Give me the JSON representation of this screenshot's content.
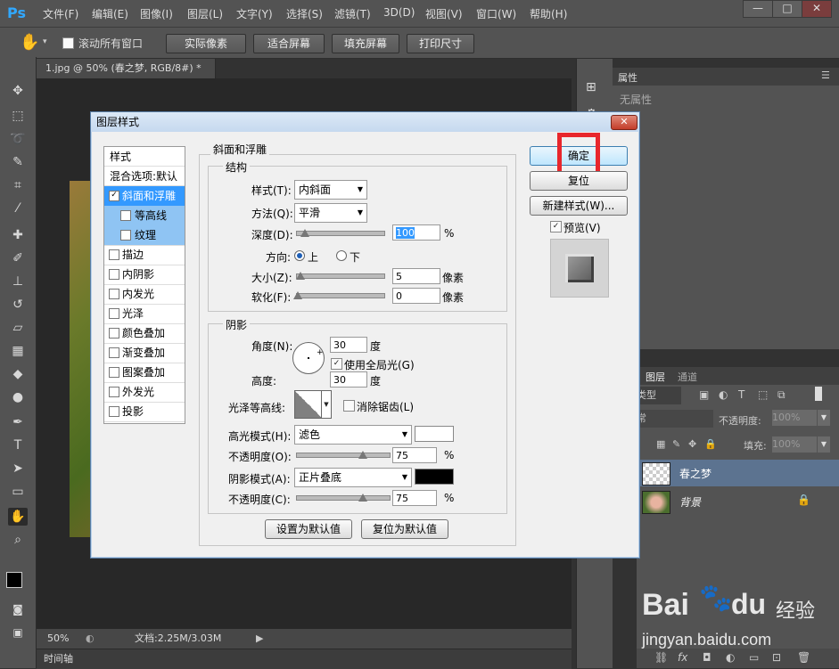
{
  "menubar": {
    "logo": "Ps",
    "items": [
      "文件(F)",
      "编辑(E)",
      "图像(I)",
      "图层(L)",
      "文字(Y)",
      "选择(S)",
      "滤镜(T)",
      "3D(D)",
      "视图(V)",
      "窗口(W)",
      "帮助(H)"
    ],
    "minimize": "—",
    "maximize": "□",
    "close": "✕"
  },
  "options": {
    "scroll_all_label": "滚动所有窗口",
    "buttons": [
      "实际像素",
      "适合屏幕",
      "填充屏幕",
      "打印尺寸"
    ]
  },
  "document": {
    "tab_title": "1.jpg @ 50% (春之梦, RGB/8#) *",
    "zoom": "50%",
    "doc_info": "文档:2.25M/3.03M",
    "timeline": "时间轴"
  },
  "properties": {
    "tab": "属性",
    "empty": "无属性"
  },
  "layers": {
    "tabs": [
      "图层",
      "通道"
    ],
    "filter_label": "类型",
    "blend_mode": "常",
    "opacity_label": "不透明度:",
    "opacity_value": "100%",
    "lock_label": "锁:",
    "fill_label": "填充:",
    "fill_value": "100%",
    "items": [
      {
        "name": "春之梦",
        "selected": true
      },
      {
        "name": "背景",
        "selected": false,
        "locked": true
      }
    ]
  },
  "dialog": {
    "title": "图层样式",
    "close": "✕",
    "style_list": {
      "header": "样式",
      "blend_default": "混合选项:默认",
      "items": [
        {
          "label": "斜面和浮雕",
          "checked": true,
          "active": true
        },
        {
          "label": "等高线",
          "checked": false,
          "sub": true
        },
        {
          "label": "纹理",
          "checked": false,
          "sub": true
        },
        {
          "label": "描边",
          "checked": false
        },
        {
          "label": "内阴影",
          "checked": false
        },
        {
          "label": "内发光",
          "checked": false
        },
        {
          "label": "光泽",
          "checked": false
        },
        {
          "label": "颜色叠加",
          "checked": false
        },
        {
          "label": "渐变叠加",
          "checked": false
        },
        {
          "label": "图案叠加",
          "checked": false
        },
        {
          "label": "外发光",
          "checked": false
        },
        {
          "label": "投影",
          "checked": false
        }
      ]
    },
    "bevel": {
      "section": "斜面和浮雕",
      "structure": "结构",
      "style_label": "样式(T):",
      "style_value": "内斜面",
      "method_label": "方法(Q):",
      "method_value": "平滑",
      "depth_label": "深度(D):",
      "depth_value": "100",
      "percent": "%",
      "direction_label": "方向:",
      "dir_up": "上",
      "dir_down": "下",
      "size_label": "大小(Z):",
      "size_value": "5",
      "soften_label": "软化(F):",
      "soften_value": "0",
      "px": "像素"
    },
    "shading": {
      "section": "阴影",
      "angle_label": "角度(N):",
      "angle_value": "30",
      "degree": "度",
      "global_light": "使用全局光(G)",
      "altitude_label": "高度:",
      "altitude_value": "30",
      "gloss_label": "光泽等高线:",
      "antialias": "消除锯齿(L)",
      "highlight_label": "高光模式(H):",
      "highlight_value": "滤色",
      "hl_opacity_label": "不透明度(O):",
      "hl_opacity_value": "75",
      "shadow_label": "阴影模式(A):",
      "shadow_value": "正片叠底",
      "sh_opacity_label": "不透明度(C):",
      "sh_opacity_value": "75",
      "percent": "%"
    },
    "buttons": {
      "ok": "确定",
      "reset": "复位",
      "new_style": "新建样式(W)...",
      "preview": "预览(V)",
      "make_default": "设置为默认值",
      "reset_default": "复位为默认值"
    },
    "colors": {
      "highlight": "#ffffff",
      "shadow": "#000000"
    }
  },
  "watermark": {
    "brand": "Bai",
    "paw": "du",
    "cn": "经验",
    "url": "jingyan.baidu.com"
  },
  "colors": {
    "accent": "#3399ff",
    "callout": "#e8262c"
  }
}
